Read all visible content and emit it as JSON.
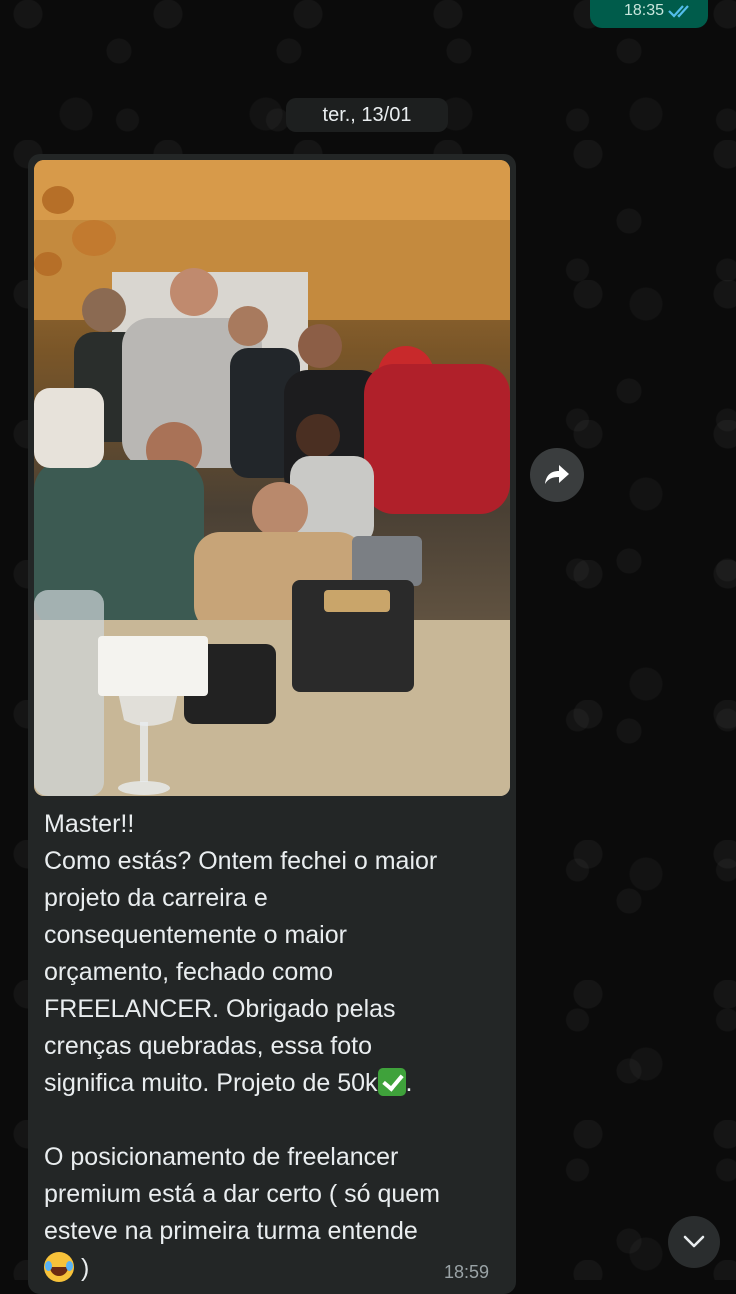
{
  "outgoing_message": {
    "time": "18:35"
  },
  "date_separator": "ter., 13/01",
  "incoming_message": {
    "lines": [
      "Master!!",
      "Como estás? Ontem fechei o maior",
      "projeto da carreira e",
      "consequentemente o maior",
      "orçamento, fechado como",
      "FREELANCER. Obrigado pelas",
      "crenças quebradas, essa foto",
      "significa muito. Projeto de 50k",
      ".",
      "",
      "O posicionamento de freelancer",
      "premium está a dar certo ( só quem",
      "esteve na primeira turma entende",
      " )"
    ],
    "time": "18:59"
  },
  "icons": {
    "forward": "forward-arrow-icon",
    "scroll_down": "chevron-down-icon",
    "read_receipt": "double-check-icon"
  },
  "colors": {
    "bubble_incoming": "#232626",
    "bubble_outgoing": "#005c4b",
    "read_ticks": "#53bdeb"
  }
}
